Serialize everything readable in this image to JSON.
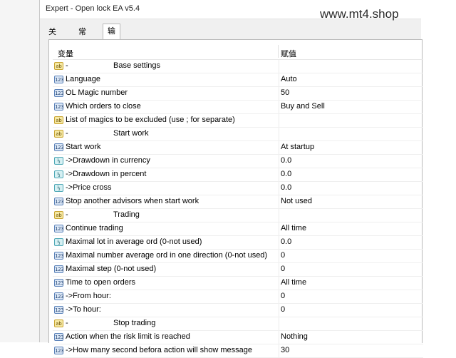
{
  "window": {
    "title": "Expert - Open lock EA v5.4"
  },
  "watermark": "www.mt4.shop",
  "tabs": [
    {
      "label": "关于"
    },
    {
      "label": "常用"
    },
    {
      "label": "输入参数"
    }
  ],
  "grid": {
    "headers": {
      "variable": "变量",
      "value": "赋值"
    },
    "rows": [
      {
        "icon": "ab",
        "name": "-",
        "section": "Base settings",
        "value": ""
      },
      {
        "icon": "123",
        "name": "Language",
        "value": "Auto"
      },
      {
        "icon": "123",
        "name": "OL Magic number",
        "value": "50"
      },
      {
        "icon": "123",
        "name": "Which orders to close",
        "value": "Buy and Sell"
      },
      {
        "icon": "ab",
        "name": "List of magics to be excluded (use ; for separate)",
        "value": ""
      },
      {
        "icon": "ab",
        "name": "-",
        "section": "Start work",
        "value": ""
      },
      {
        "icon": "123",
        "name": "Start work",
        "value": "At startup"
      },
      {
        "icon": "v2",
        "name": "->Drawdown in currency",
        "value": "0.0"
      },
      {
        "icon": "v2",
        "name": "->Drawdown in percent",
        "value": "0.0"
      },
      {
        "icon": "v2",
        "name": "->Price cross",
        "value": "0.0"
      },
      {
        "icon": "123",
        "name": "Stop another advisors when start work",
        "value": "Not used"
      },
      {
        "icon": "ab",
        "name": "-",
        "section": "Trading",
        "value": ""
      },
      {
        "icon": "123",
        "name": "Continue trading",
        "value": "All time"
      },
      {
        "icon": "v2",
        "name": "Maximal lot in average ord (0-not used)",
        "value": "0.0"
      },
      {
        "icon": "123",
        "name": "Maximal number average ord in one direction (0-not used)",
        "value": "0"
      },
      {
        "icon": "123",
        "name": "Maximal step (0-not used)",
        "value": "0"
      },
      {
        "icon": "123",
        "name": "Time to open orders",
        "value": "All time"
      },
      {
        "icon": "123",
        "name": "->From hour:",
        "value": "0"
      },
      {
        "icon": "123",
        "name": "->To hour:",
        "value": "0"
      },
      {
        "icon": "ab",
        "name": "-",
        "section": "Stop trading",
        "value": ""
      },
      {
        "icon": "123",
        "name": "Action when the risk limit is reached",
        "value": "Nothing"
      },
      {
        "icon": "123",
        "name": "->How many second befora action will show message",
        "value": "30"
      }
    ]
  },
  "icons": {
    "ab": {
      "glyph": "ab",
      "semantic": "string-param-icon"
    },
    "123": {
      "glyph": "123",
      "semantic": "integer-param-icon"
    },
    "v2": {
      "glyph": "½",
      "semantic": "double-param-icon"
    }
  }
}
